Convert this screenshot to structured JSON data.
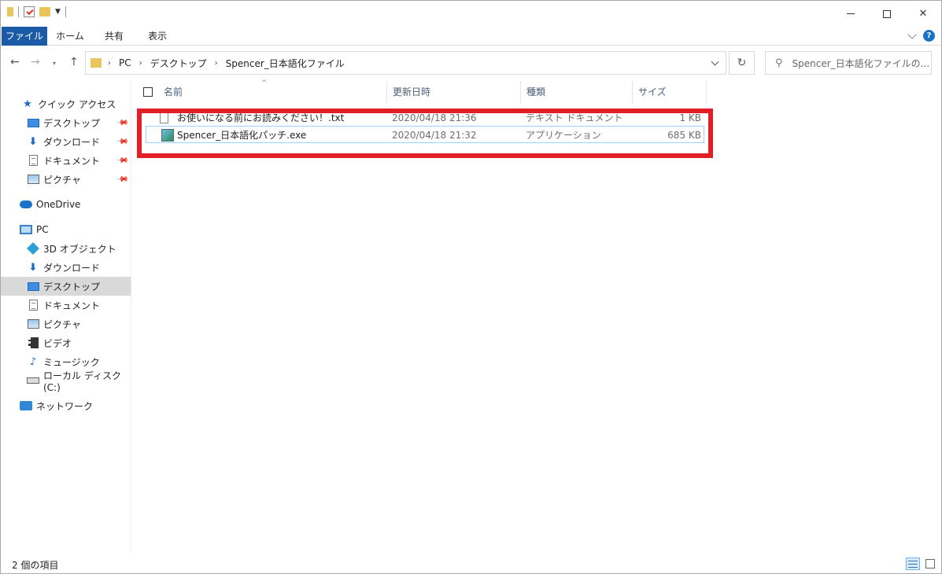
{
  "window": {
    "controls": {
      "minimize": "—",
      "maximize": "□",
      "close": "✕"
    }
  },
  "ribbon": {
    "tabs": [
      "ファイル",
      "ホーム",
      "共有",
      "表示"
    ],
    "help": "?"
  },
  "address": {
    "breadcrumbs": [
      "PC",
      "デスクトップ",
      "Spencer_日本語化ファイル"
    ],
    "separator": "›",
    "search_placeholder": "Spencer_日本語化ファイルの..."
  },
  "sidebar": {
    "quick_access": "クイック アクセス",
    "quick_items": [
      "デスクトップ",
      "ダウンロード",
      "ドキュメント",
      "ピクチャ"
    ],
    "onedrive": "OneDrive",
    "pc": "PC",
    "pc_items": [
      "3D オブジェクト",
      "ダウンロード",
      "デスクトップ",
      "ドキュメント",
      "ピクチャ",
      "ビデオ",
      "ミュージック",
      "ローカル ディスク (C:)"
    ],
    "network": "ネットワーク"
  },
  "columns": [
    "名前",
    "更新日時",
    "種類",
    "サイズ"
  ],
  "files": [
    {
      "name": "お使いになる前にお読みください！.txt",
      "modified": "2020/04/18 21:36",
      "type": "テキスト ドキュメント",
      "size": "1 KB"
    },
    {
      "name": "Spencer_日本語化パッチ.exe",
      "modified": "2020/04/18 21:32",
      "type": "アプリケーション",
      "size": "685 KB"
    }
  ],
  "status": {
    "item_count": "2 個の項目"
  },
  "colors": {
    "file_tab": "#1a5aa6",
    "highlight": "#e21f26",
    "selection_border": "#99d1ff"
  }
}
